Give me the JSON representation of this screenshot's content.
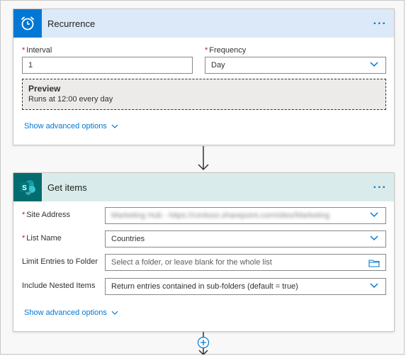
{
  "recurrence": {
    "title": "Recurrence",
    "more": "...",
    "interval_label": "Interval",
    "interval_value": "1",
    "frequency_label": "Frequency",
    "frequency_value": "Day",
    "preview_title": "Preview",
    "preview_text": "Runs at 12:00 every day",
    "advanced_label": "Show advanced options",
    "accent": "#0078d4",
    "header_bg": "#dbe9f9"
  },
  "get_items": {
    "title": "Get items",
    "more": "...",
    "site_address_label": "Site Address",
    "site_address_value": "Marketing Hub - https://contoso.sharepoint.com/sites/Marketing",
    "list_name_label": "List Name",
    "list_name_value": "Countries",
    "limit_label": "Limit Entries to Folder",
    "limit_placeholder": "Select a folder, or leave blank for the whole list",
    "nested_label": "Include Nested Items",
    "nested_value": "Return entries contained in sub-folders (default = true)",
    "advanced_label": "Show advanced options",
    "icon_text": "S",
    "accent": "#036c70",
    "header_bg": "#d9eceb"
  }
}
